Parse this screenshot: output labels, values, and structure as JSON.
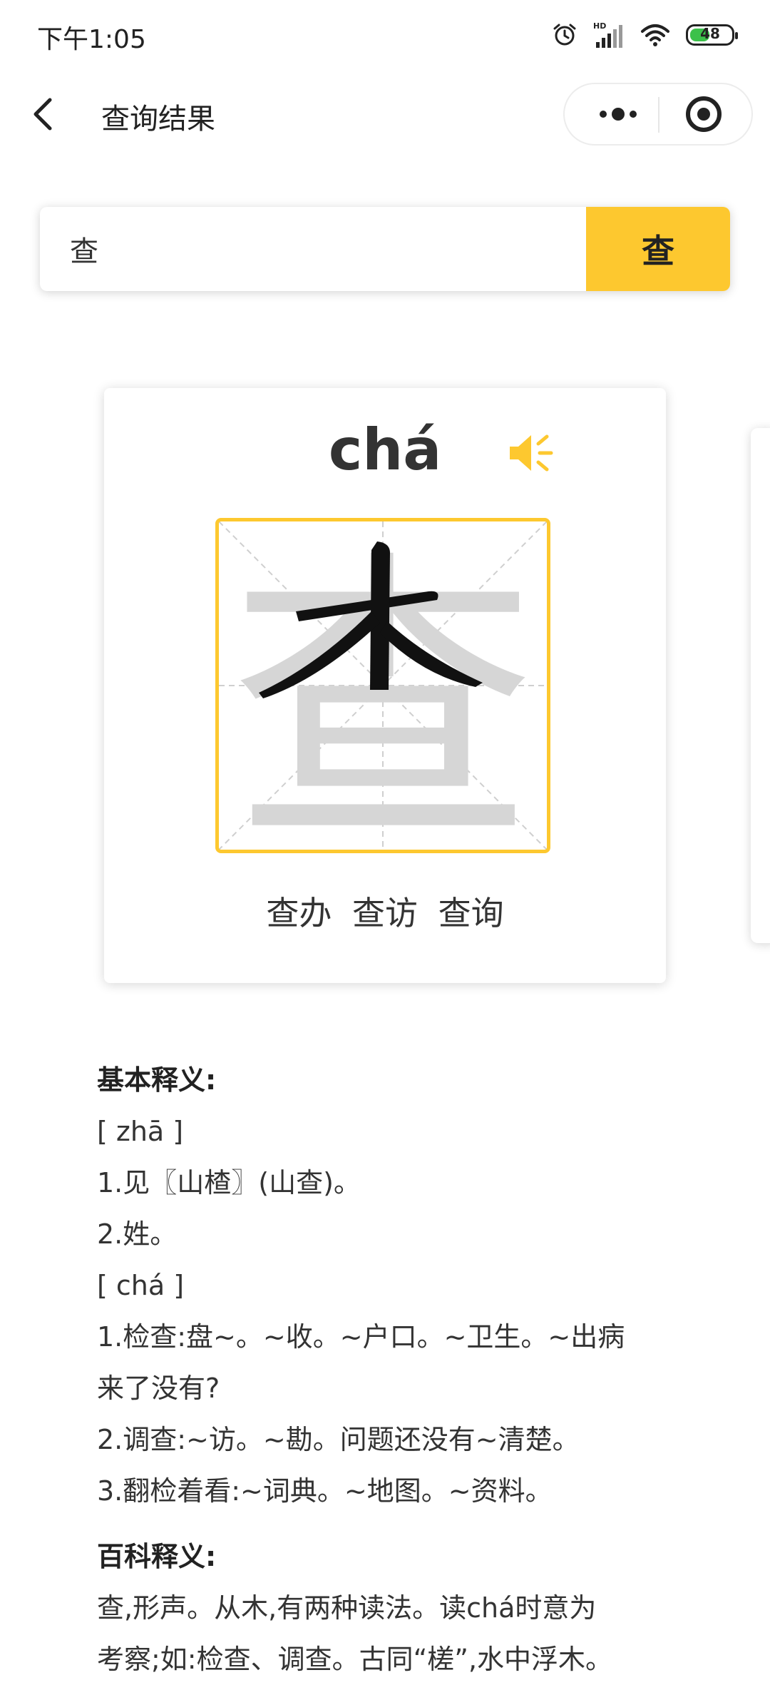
{
  "status_bar": {
    "time": "下午1:05",
    "battery": "48",
    "battery_level": 0.48,
    "battery_color": "#3cc14a"
  },
  "nav": {
    "title": "查询结果"
  },
  "search": {
    "value": "查",
    "button_label": "查"
  },
  "card": {
    "pinyin": "chá",
    "character": "查",
    "words": "查办 查访 查询"
  },
  "definition": {
    "basic_title": "基本释义:",
    "lines": [
      "[ zhā ]",
      "1.见〖山楂〗(山查)。",
      "2.姓。",
      "[ chá ]",
      "1.检查:盘~。~收。~户口。~卫生。~出病",
      "来了没有?",
      "2.调查:~访。~勘。问题还没有~清楚。",
      "3.翻检着看:~词典。~地图。~资料。"
    ],
    "baike_title": "百科释义:",
    "baike_lines": [
      "查,形声。从木,有两种读法。读chá时意为",
      "考察;如:检查、调查。古同“槎”,水中浮木。"
    ]
  },
  "colors": {
    "accent": "#fdc82f",
    "text": "#333333"
  }
}
